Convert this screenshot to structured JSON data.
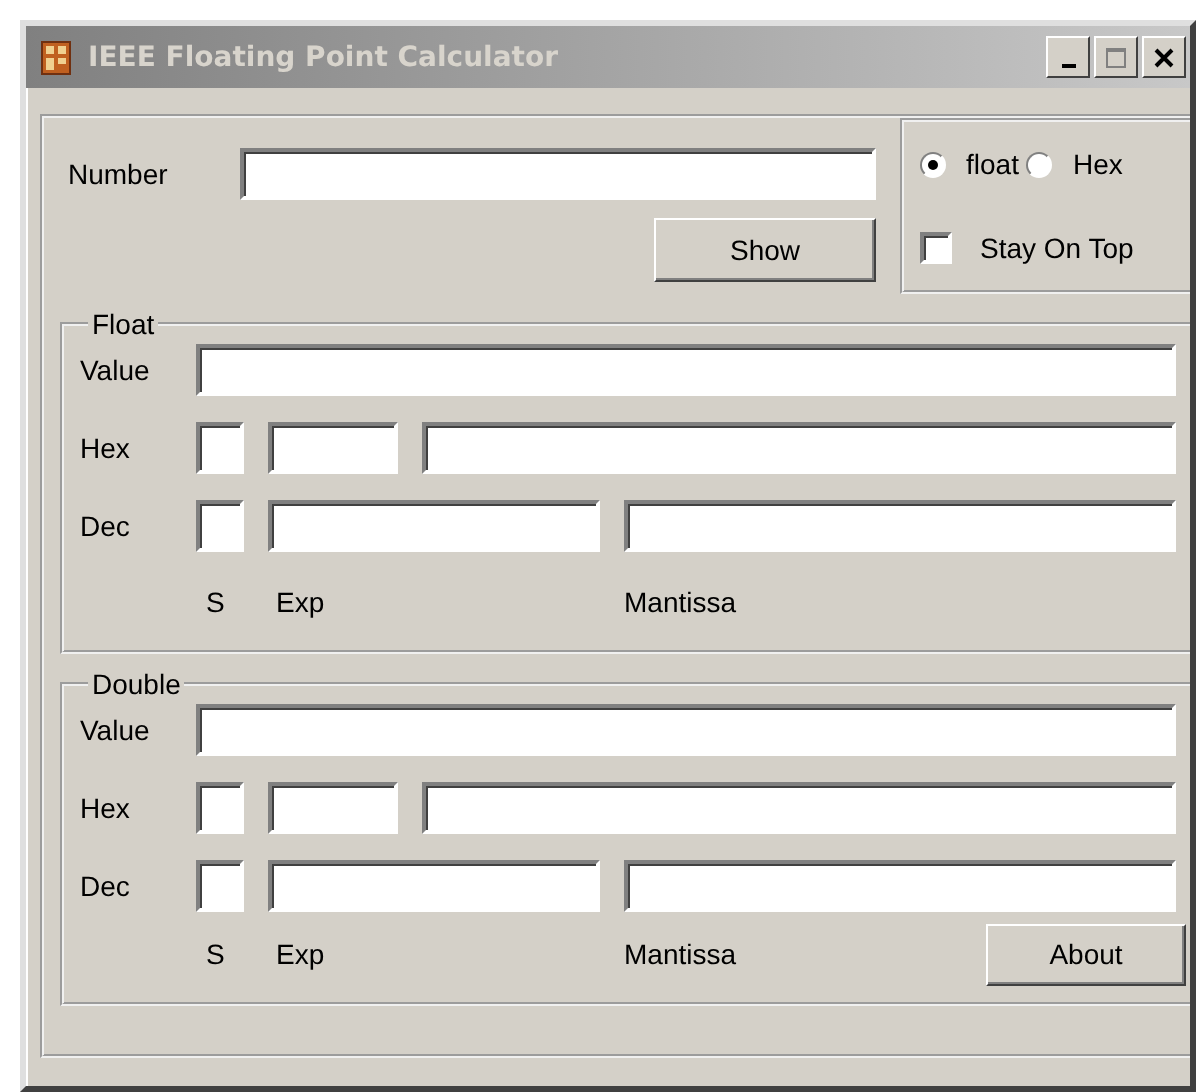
{
  "window": {
    "title": "IEEE Floating Point Calculator"
  },
  "number": {
    "label": "Number"
  },
  "show_button": "Show",
  "mode_options": [
    {
      "label": "float",
      "selected": true
    },
    {
      "label": "Hex",
      "selected": false
    }
  ],
  "stay_on_top": {
    "label": "Stay On Top",
    "checked": false
  },
  "sections": [
    {
      "title": "Float",
      "rows": [
        {
          "label": "Value",
          "kind": "value"
        },
        {
          "label": "Hex",
          "kind": "hex"
        },
        {
          "label": "Dec",
          "kind": "dec"
        }
      ],
      "captions": [
        "S",
        "Exp",
        "Mantissa"
      ]
    },
    {
      "title": "Double",
      "rows": [
        {
          "label": "Value",
          "kind": "value"
        },
        {
          "label": "Hex",
          "kind": "hex"
        },
        {
          "label": "Dec",
          "kind": "dec"
        }
      ],
      "captions": [
        "S",
        "Exp",
        "Mantissa"
      ]
    }
  ],
  "about_button": "About"
}
